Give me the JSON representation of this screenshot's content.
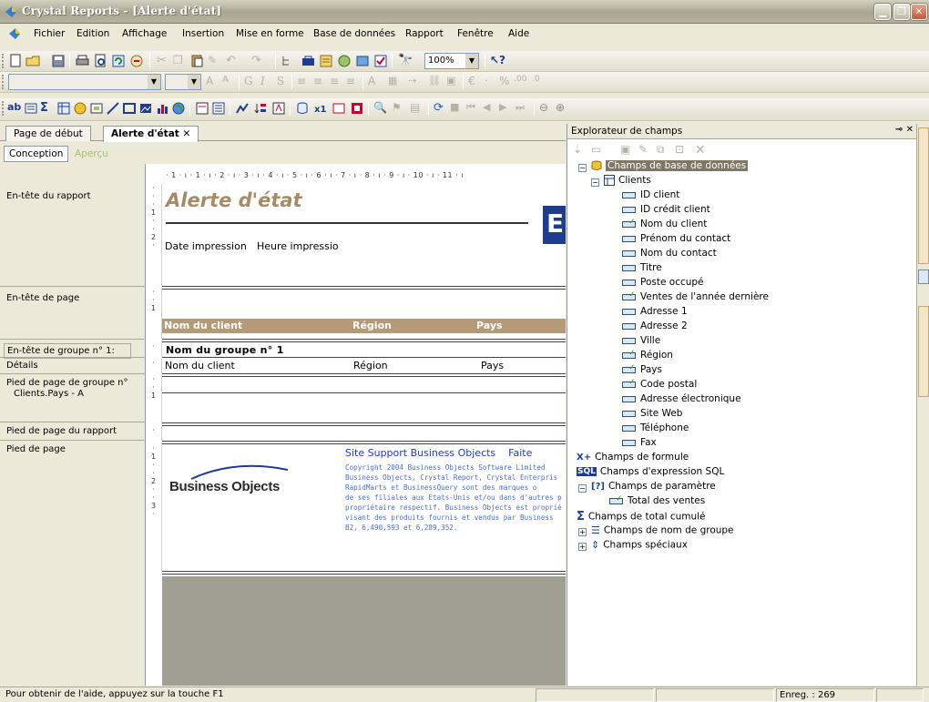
{
  "window": {
    "title": "Crystal Reports - [Alerte d'état]"
  },
  "menu": [
    "Fichier",
    "Edition",
    "Affichage",
    "Insertion",
    "Mise en forme",
    "Base de données",
    "Rapport",
    "Fenêtre",
    "Aide"
  ],
  "toolbar": {
    "zoom": "100%",
    "format_bold": "G",
    "format_italic": "I",
    "format_underline": "S",
    "currency": "€",
    "percent": "%"
  },
  "tabs": [
    {
      "label": "Page de début",
      "active": false
    },
    {
      "label": "Alerte d'état",
      "active": true
    }
  ],
  "view_tabs": {
    "design": "Conception",
    "preview": "Aperçu"
  },
  "ruler": "· 1 · ı · 1 · ı · 2 · ı · 3 · ı · 4 · ı · 5 · ı · 6 · ı · 7 · ı · 8 · ı · 9 · ı · 10 · ı · 11 · ı",
  "sections": {
    "report_header": "En-tête du rapport",
    "page_header": "En-tête de page",
    "group_header": "En-tête de groupe n° 1:",
    "details": "Détails",
    "group_footer": "Pied de page de groupe n°",
    "group_footer_sub": "Clients.Pays - A",
    "report_footer": "Pied de page du rapport",
    "page_footer": "Pied de page"
  },
  "report": {
    "title": "Alerte d'état",
    "logo_letter": "E",
    "print_date": "Date impression",
    "print_time": "Heure impressio",
    "col_client": "Nom du client",
    "col_region": "Région",
    "col_country": "Pays",
    "group_name": "Nom du groupe n° 1",
    "det_client": "Nom du client",
    "det_region": "Région",
    "det_country": "Pays",
    "bo_logo": "Business Objects",
    "support_link": "Site Support Business Objects",
    "support_link2": "Faite",
    "copyright": [
      "Copyright 2004 Business Objects Software Limited",
      "Business Objects, Crystal Report, Crystal Enterpris",
      "RapidMarts et BusinessQuery sont des marques o",
      "de ses filiales aux Etats-Unis et/ou dans d'autres p",
      "propriétaire respectif. Business Objects est proprié",
      "visant des produits fournis et vendus par Business",
      "B2, 6,490,593 et 6,289,352."
    ]
  },
  "field_explorer": {
    "title": "Explorateur de champs",
    "db_fields": "Champs de base de données",
    "table": "Clients",
    "fields": [
      {
        "name": "ID client",
        "used": false
      },
      {
        "name": "ID crédit client",
        "used": false
      },
      {
        "name": "Nom du client",
        "used": true
      },
      {
        "name": "Prénom du contact",
        "used": false
      },
      {
        "name": "Nom du contact",
        "used": false
      },
      {
        "name": "Titre",
        "used": false
      },
      {
        "name": "Poste occupé",
        "used": false
      },
      {
        "name": "Ventes de l'année dernière",
        "used": true
      },
      {
        "name": "Adresse 1",
        "used": false
      },
      {
        "name": "Adresse 2",
        "used": false
      },
      {
        "name": "Ville",
        "used": false
      },
      {
        "name": "Région",
        "used": true
      },
      {
        "name": "Pays",
        "used": true
      },
      {
        "name": "Code postal",
        "used": true
      },
      {
        "name": "Adresse électronique",
        "used": false
      },
      {
        "name": "Site Web",
        "used": false
      },
      {
        "name": "Téléphone",
        "used": false
      },
      {
        "name": "Fax",
        "used": false
      }
    ],
    "formula_fields": "Champs de formule",
    "sql_fields": "Champs d'expression SQL",
    "param_fields": "Champs de paramètre",
    "param_item": "Total des ventes",
    "running_total": "Champs de total cumulé",
    "group_name_fields": "Champs de nom de groupe",
    "special_fields": "Champs spéciaux"
  },
  "status": {
    "help": "Pour obtenir de l'aide, appuyez sur la touche F1",
    "records": "Enreg. : 269"
  },
  "colors": {
    "title_text": "#a68b66",
    "band": "#b59a77",
    "link": "#1c3bd9",
    "selection": "#7d7768"
  }
}
